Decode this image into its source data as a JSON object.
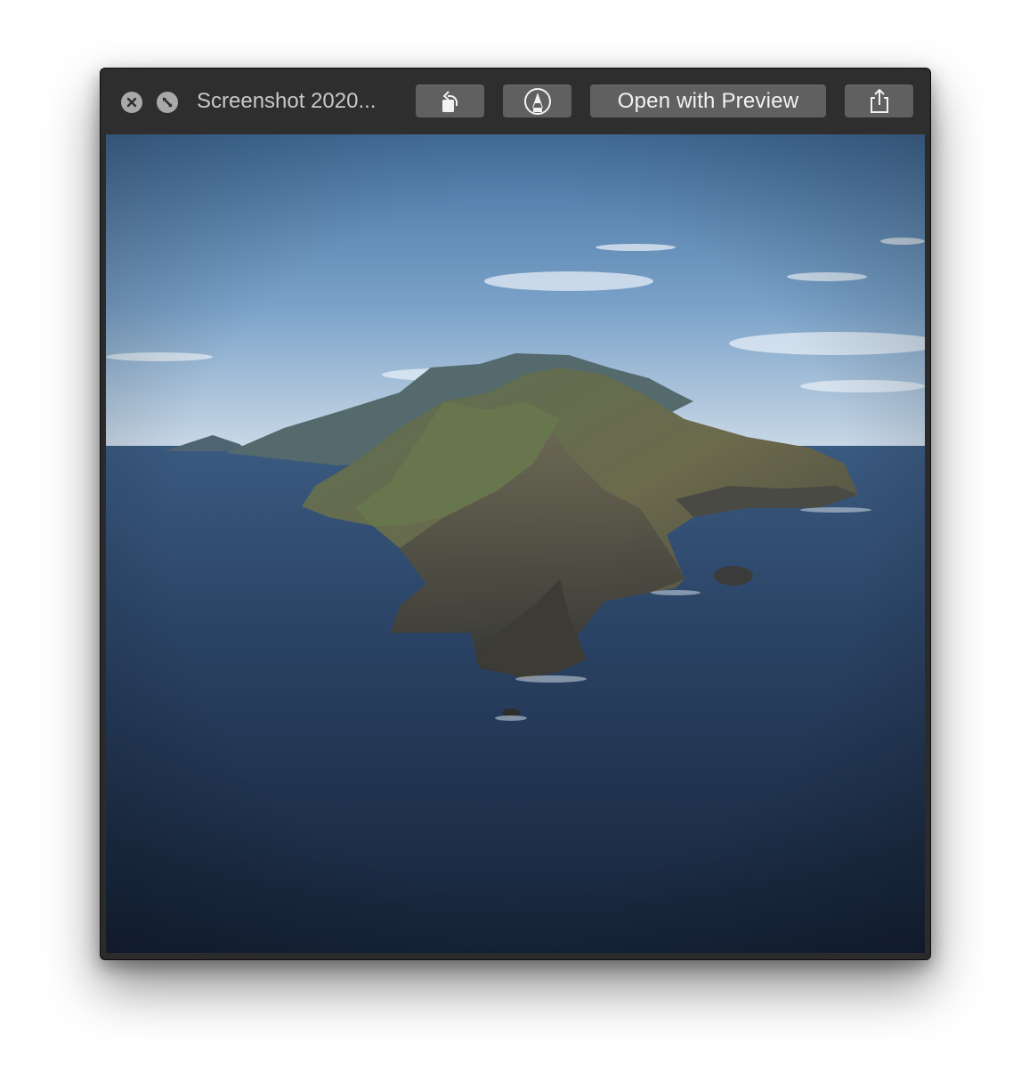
{
  "window": {
    "title": "Screenshot 2020...",
    "close_icon": "close-icon",
    "fullscreen_icon": "fullscreen-icon"
  },
  "toolbar": {
    "rotate_icon": "rotate-left-icon",
    "markup_icon": "markup-pen-icon",
    "open_with_label": "Open with Preview",
    "share_icon": "share-icon"
  },
  "preview": {
    "image_subject": "island-landscape",
    "colors": {
      "sky_top": "#44709e",
      "sky_horizon": "#c9d8e6",
      "sea_top": "#3a5a80",
      "sea_bottom": "#162338",
      "chrome": "#2e2e2e",
      "button": "#606060"
    }
  }
}
